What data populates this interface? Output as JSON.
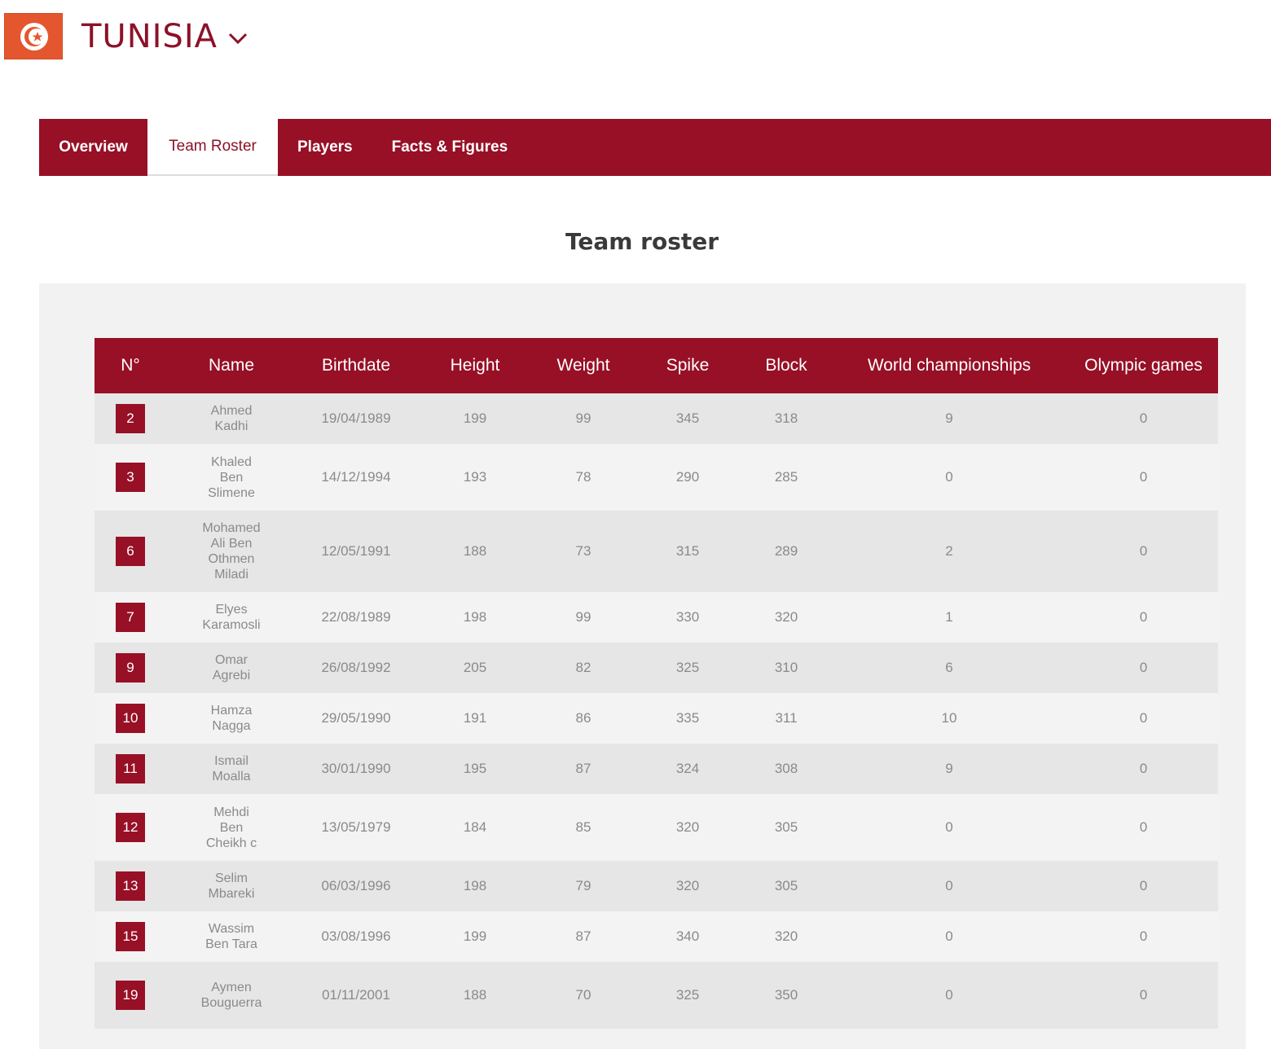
{
  "header": {
    "country": "TUNISIA",
    "flag_icon": "tunisia-flag-icon",
    "dropdown_icon": "chevron-down-icon"
  },
  "tabs": [
    {
      "label": "Overview",
      "active": false
    },
    {
      "label": "Team Roster",
      "active": true
    },
    {
      "label": "Players",
      "active": false
    },
    {
      "label": "Facts & Figures",
      "active": false
    }
  ],
  "section_title": "Team roster",
  "table": {
    "columns": [
      "N°",
      "Name",
      "Birthdate",
      "Height",
      "Weight",
      "Spike",
      "Block",
      "World championships",
      "Olympic games"
    ],
    "rows": [
      {
        "no": "2",
        "name": "Ahmed\nKadhi",
        "birthdate": "19/04/1989",
        "height": "199",
        "weight": "99",
        "spike": "345",
        "block": "318",
        "wc": "9",
        "og": "0"
      },
      {
        "no": "3",
        "name": "Khaled\nBen\nSlimene",
        "birthdate": "14/12/1994",
        "height": "193",
        "weight": "78",
        "spike": "290",
        "block": "285",
        "wc": "0",
        "og": "0"
      },
      {
        "no": "6",
        "name": "Mohamed\nAli Ben\nOthmen\nMiladi",
        "birthdate": "12/05/1991",
        "height": "188",
        "weight": "73",
        "spike": "315",
        "block": "289",
        "wc": "2",
        "og": "0"
      },
      {
        "no": "7",
        "name": "Elyes\nKaramosli",
        "birthdate": "22/08/1989",
        "height": "198",
        "weight": "99",
        "spike": "330",
        "block": "320",
        "wc": "1",
        "og": "0"
      },
      {
        "no": "9",
        "name": "Omar\nAgrebi",
        "birthdate": "26/08/1992",
        "height": "205",
        "weight": "82",
        "spike": "325",
        "block": "310",
        "wc": "6",
        "og": "0"
      },
      {
        "no": "10",
        "name": "Hamza\nNagga",
        "birthdate": "29/05/1990",
        "height": "191",
        "weight": "86",
        "spike": "335",
        "block": "311",
        "wc": "10",
        "og": "0"
      },
      {
        "no": "11",
        "name": "Ismail\nMoalla",
        "birthdate": "30/01/1990",
        "height": "195",
        "weight": "87",
        "spike": "324",
        "block": "308",
        "wc": "9",
        "og": "0"
      },
      {
        "no": "12",
        "name": "Mehdi\nBen\nCheikh c",
        "birthdate": "13/05/1979",
        "height": "184",
        "weight": "85",
        "spike": "320",
        "block": "305",
        "wc": "0",
        "og": "0"
      },
      {
        "no": "13",
        "name": "Selim\nMbareki",
        "birthdate": "06/03/1996",
        "height": "198",
        "weight": "79",
        "spike": "320",
        "block": "305",
        "wc": "0",
        "og": "0"
      },
      {
        "no": "15",
        "name": "Wassim\nBen Tara",
        "birthdate": "03/08/1996",
        "height": "199",
        "weight": "87",
        "spike": "340",
        "block": "320",
        "wc": "0",
        "og": "0"
      },
      {
        "no": "19",
        "name": "Aymen\nBouguerra",
        "birthdate": "01/11/2001",
        "height": "188",
        "weight": "70",
        "spike": "325",
        "block": "350",
        "wc": "0",
        "og": "0"
      }
    ]
  }
}
